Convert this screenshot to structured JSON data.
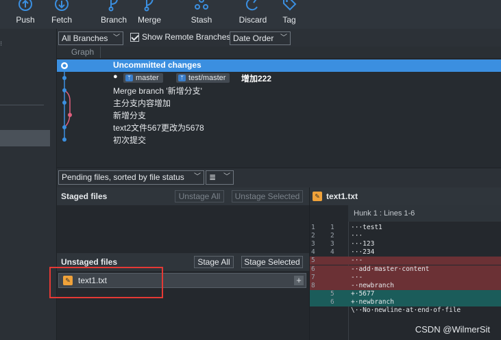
{
  "toolbar": {
    "buttons": [
      {
        "label": "Push",
        "icon": "push-icon"
      },
      {
        "label": "Fetch",
        "icon": "fetch-icon"
      },
      {
        "label": "Branch",
        "icon": "branch-icon"
      },
      {
        "label": "Merge",
        "icon": "merge-icon"
      },
      {
        "label": "Stash",
        "icon": "stash-icon"
      },
      {
        "label": "Discard",
        "icon": "discard-icon"
      },
      {
        "label": "Tag",
        "icon": "tag-icon"
      }
    ]
  },
  "history": {
    "branch_filter": "All Branches",
    "show_remote_label": "Show Remote Branches",
    "show_remote_checked": true,
    "order": "Date Order",
    "graph_column": "Graph"
  },
  "commits": [
    {
      "message": "Uncommitted changes",
      "selected": true
    },
    {
      "message": "增加222",
      "refs": [
        "master",
        "test/master"
      ]
    },
    {
      "message": "Merge branch '新增分支'"
    },
    {
      "message": "主分支内容增加"
    },
    {
      "message": "新增分支"
    },
    {
      "message": "text2文件567更改为5678"
    },
    {
      "message": "初次提交"
    }
  ],
  "files": {
    "sort_label": "Pending files, sorted by file status",
    "view_icon": "list-view-icon",
    "staged": {
      "title": "Staged files",
      "unstage_all": "Unstage All",
      "unstage_selected": "Unstage Selected"
    },
    "unstaged": {
      "title": "Unstaged files",
      "stage_all": "Stage All",
      "stage_selected": "Stage Selected",
      "items": [
        {
          "name": "text1.txt"
        }
      ]
    }
  },
  "diff": {
    "file": "text1.txt",
    "hunk": "Hunk 1 : Lines 1-6",
    "lines": [
      {
        "old": "1",
        "new": "1",
        "text": "···test1",
        "kind": "ctx"
      },
      {
        "old": "2",
        "new": "2",
        "text": "···",
        "kind": "ctx"
      },
      {
        "old": "3",
        "new": "3",
        "text": "···123",
        "kind": "ctx"
      },
      {
        "old": "4",
        "new": "4",
        "text": "···234",
        "kind": "ctx"
      },
      {
        "old": "5",
        "new": "",
        "text": "-·-",
        "kind": "del"
      },
      {
        "old": "6",
        "new": "",
        "text": "-·add·master·content",
        "kind": "del"
      },
      {
        "old": "7",
        "new": "",
        "text": "-·-",
        "kind": "del"
      },
      {
        "old": "8",
        "new": "",
        "text": "-·newbranch",
        "kind": "del"
      },
      {
        "old": "",
        "new": "5",
        "text": "+·5677",
        "kind": "add"
      },
      {
        "old": "",
        "new": "6",
        "text": "+·newbranch",
        "kind": "add"
      },
      {
        "old": "",
        "new": "",
        "text": "\\··No·newline·at·end·of·file",
        "kind": "ctx"
      }
    ]
  },
  "watermark": "CSDN @WilmerSit",
  "colors": {
    "selection": "#3b8fe0",
    "graph_line": "#3b8fe0",
    "branch_line": "#e0607e",
    "deleted_bg": "#6b3135",
    "added_bg": "#1b5c5a",
    "file_modified": "#f0a23a",
    "highlight_box": "#e53935"
  }
}
